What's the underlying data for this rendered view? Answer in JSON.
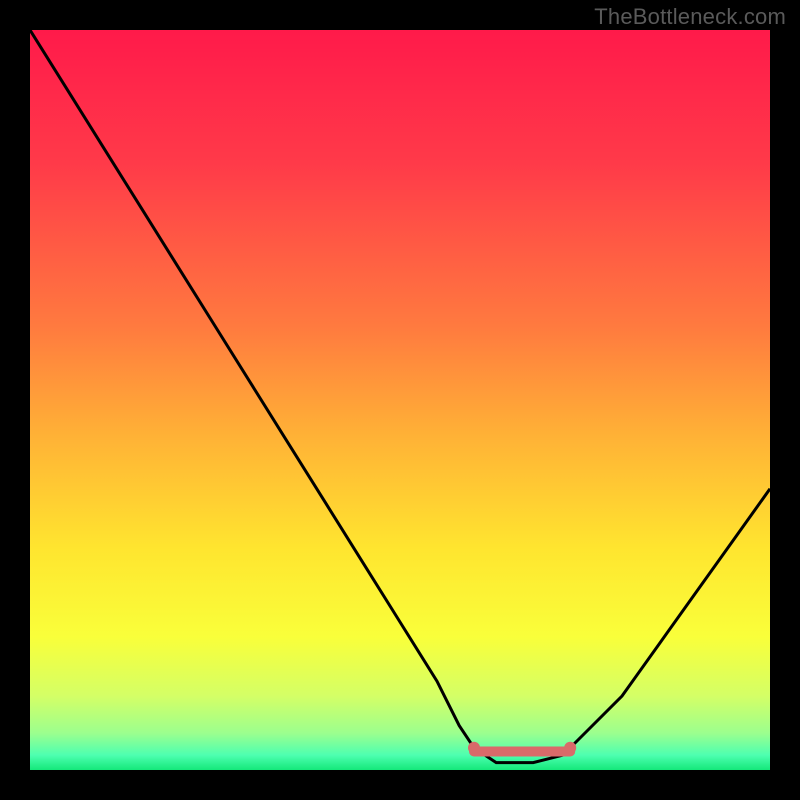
{
  "watermark": "TheBottleneck.com",
  "chart_data": {
    "type": "line",
    "title": "",
    "xlabel": "",
    "ylabel": "",
    "xlim": [
      0,
      100
    ],
    "ylim": [
      0,
      100
    ],
    "gradient_stops": [
      {
        "offset": 0,
        "color": "#ff1a4a"
      },
      {
        "offset": 18,
        "color": "#ff3a49"
      },
      {
        "offset": 40,
        "color": "#ff7a3f"
      },
      {
        "offset": 55,
        "color": "#ffb236"
      },
      {
        "offset": 70,
        "color": "#ffe52f"
      },
      {
        "offset": 82,
        "color": "#f9ff3a"
      },
      {
        "offset": 90,
        "color": "#d4ff66"
      },
      {
        "offset": 95,
        "color": "#9cff8e"
      },
      {
        "offset": 98,
        "color": "#4dffb0"
      },
      {
        "offset": 100,
        "color": "#14e87a"
      }
    ],
    "series": [
      {
        "name": "bottleneck-curve",
        "color": "#000000",
        "x": [
          0,
          5,
          10,
          15,
          20,
          25,
          30,
          35,
          40,
          45,
          50,
          55,
          58,
          60,
          63,
          68,
          72,
          75,
          80,
          85,
          90,
          95,
          100
        ],
        "values": [
          100,
          92,
          84,
          76,
          68,
          60,
          52,
          44,
          36,
          28,
          20,
          12,
          6,
          3,
          1,
          1,
          2,
          5,
          10,
          17,
          24,
          31,
          38
        ]
      }
    ],
    "markers": [
      {
        "name": "optimal-range-left",
        "x": 60,
        "y": 3,
        "color": "#d96a6a"
      },
      {
        "name": "optimal-range-right",
        "x": 73,
        "y": 3,
        "color": "#d96a6a"
      }
    ],
    "optimal_band": {
      "x_start": 60,
      "x_end": 73,
      "y": 2.5,
      "color": "#d96a6a"
    }
  }
}
